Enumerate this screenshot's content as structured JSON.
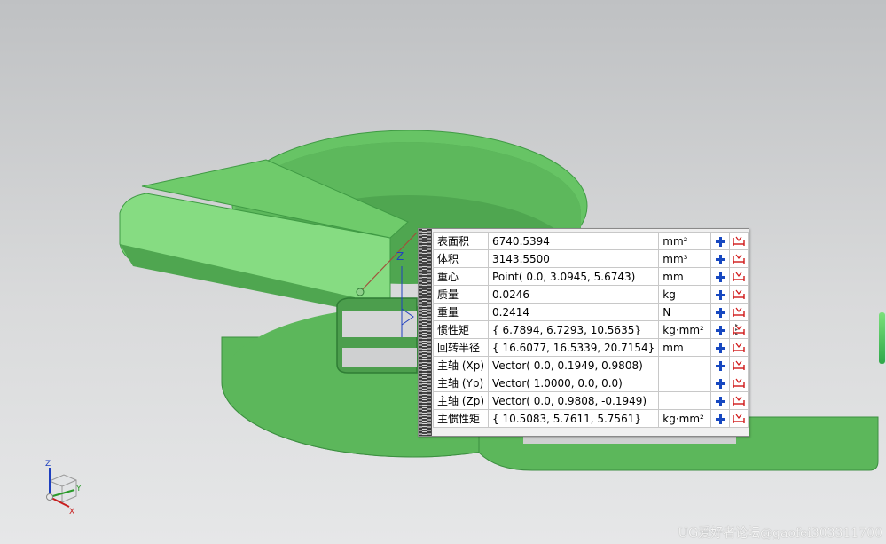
{
  "measurement_results": {
    "rows": [
      {
        "name": "表面积",
        "value": "6740.5394",
        "unit": "mm²"
      },
      {
        "name": "体积",
        "value": "3143.5500",
        "unit": "mm³"
      },
      {
        "name": "重心",
        "value": "Point( 0.0, 3.0945, 5.6743)",
        "unit": "mm"
      },
      {
        "name": "质量",
        "value": "0.0246",
        "unit": "kg"
      },
      {
        "name": "重量",
        "value": "0.2414",
        "unit": "N"
      },
      {
        "name": "惯性矩",
        "value": "{ 6.7894, 6.7293, 10.5635}",
        "unit": "kg·mm²"
      },
      {
        "name": "回转半径",
        "value": "{ 16.6077, 16.5339, 20.7154}",
        "unit": "mm"
      },
      {
        "name": "主轴 (Xp)",
        "value": "Vector( 0.0, 0.1949, 0.9808)",
        "unit": ""
      },
      {
        "name": "主轴 (Yp)",
        "value": "Vector( 1.0000, 0.0, 0.0)",
        "unit": ""
      },
      {
        "name": "主轴 (Zp)",
        "value": "Vector( 0.0, 0.9808, -0.1949)",
        "unit": ""
      },
      {
        "name": "主惯性矩",
        "value": "{ 10.5083, 5.7611, 5.7561}",
        "unit": "kg·mm²"
      }
    ],
    "row_icons": [
      "add-to-result-icon",
      "create-dimension-icon"
    ]
  },
  "triad": {
    "z_label": "Z",
    "y_label": "Y",
    "x_label": "X"
  },
  "model_axis_label": "Z",
  "watermark": "UG爱好者论坛@gaofei303311700",
  "colors": {
    "model_green": "#5fbf5f",
    "model_light": "#8ee08a",
    "model_dark": "#3f9a44",
    "background_top": "#bfc1c3",
    "background_bottom": "#e6e7e8",
    "icon_blue": "#1748c0",
    "icon_red": "#d01818"
  }
}
